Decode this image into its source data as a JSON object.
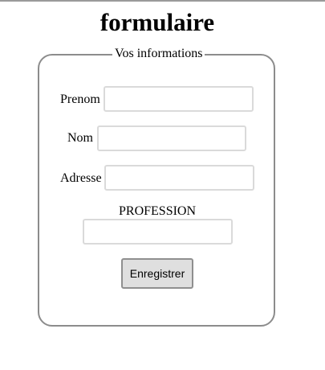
{
  "page": {
    "title": "formulaire"
  },
  "form": {
    "legend": "Vos informations",
    "fields": {
      "prenom": {
        "label": "Prenom",
        "value": "",
        "placeholder": ""
      },
      "nom": {
        "label": "Nom",
        "value": "",
        "placeholder": ""
      },
      "adresse": {
        "label": "Adresse",
        "value": "",
        "placeholder": ""
      },
      "profession": {
        "label": "PROFESSION",
        "value": "",
        "placeholder": ""
      }
    },
    "submit_label": "Enregistrer"
  }
}
